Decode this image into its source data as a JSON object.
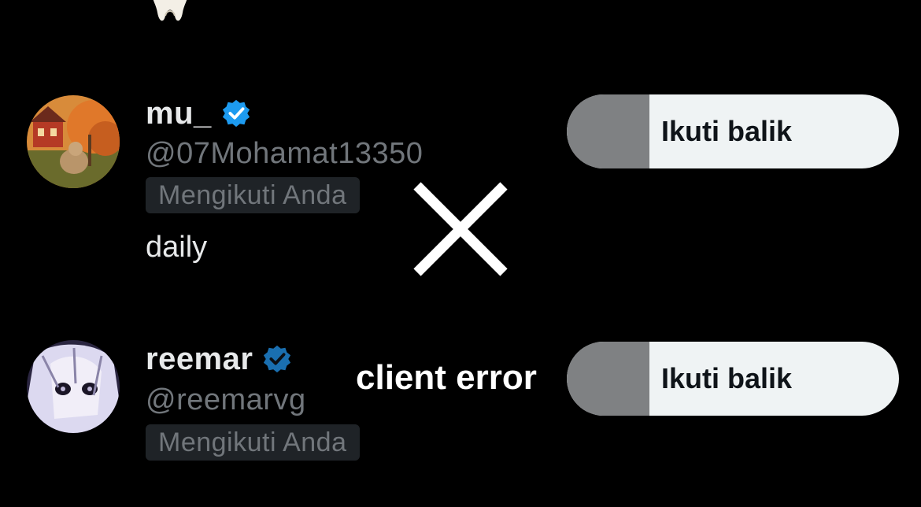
{
  "users": [
    {
      "display_name": "mu_",
      "handle": "@07Mohamat13350",
      "follows_you": "Mengikuti Anda",
      "bio": "daily",
      "verified": true,
      "follow_button_label": "Ikuti balik"
    },
    {
      "display_name": "reemar",
      "handle": "@reemarvg",
      "follows_you": "Mengikuti Anda",
      "bio": "",
      "verified": true,
      "follow_button_label": "Ikuti balik"
    }
  ],
  "overlay": {
    "cross_icon": "x-mark-icon",
    "error_text": "client error"
  },
  "colors": {
    "background": "#000000",
    "verified_badge_1": "#1d9bf0",
    "verified_badge_2": "#1a6fb0",
    "button_bg": "#eff3f4",
    "button_overlay": "#7f8183",
    "secondary_text": "#71767b"
  }
}
